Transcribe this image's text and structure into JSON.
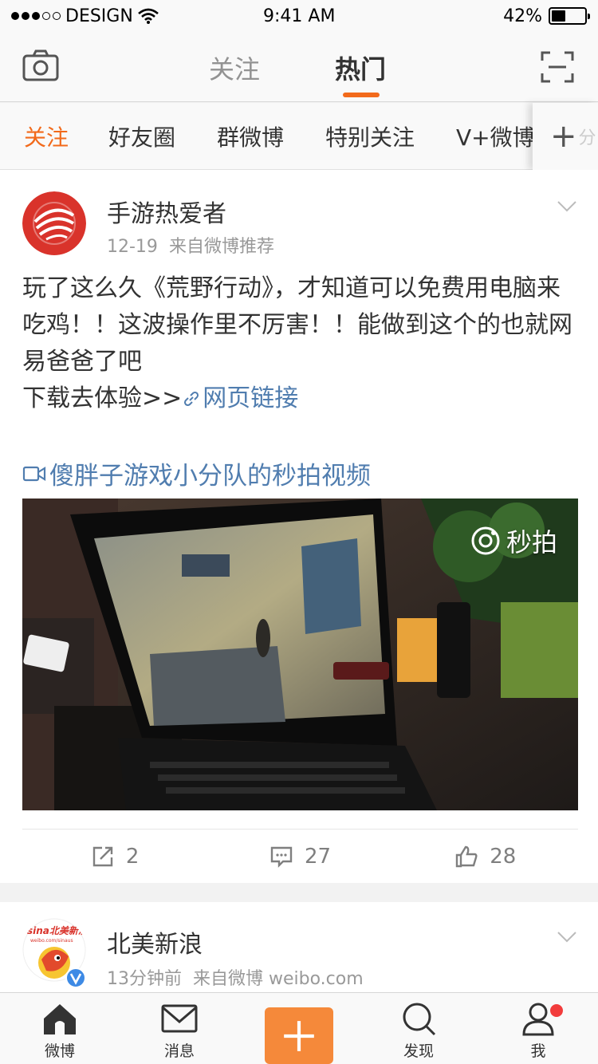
{
  "status_bar": {
    "carrier": "DESIGN",
    "time": "9:41 AM",
    "battery_percent": "42%",
    "battery_level": 0.42,
    "signal_bars_filled": 3,
    "signal_bars_total": 5
  },
  "nav": {
    "tab_follow": "关注",
    "tab_hot": "热门",
    "active_tab": "热门",
    "camera_icon": "camera-icon",
    "scan_icon": "scan-icon"
  },
  "groups": {
    "items": [
      "关注",
      "好友圈",
      "群微博",
      "特别关注",
      "V+微博"
    ],
    "active_index": 0,
    "add_symbol": "+",
    "add_fade": "分"
  },
  "post1": {
    "author": "手游热爱者",
    "date": "12-19",
    "source": "来自微博推荐",
    "text_line1": "玩了这么久《荒野行动》，才知道可以免费用电脑来吃鸡！！这波操作里不厉害！！能做到这个的也就网易爸爸了吧",
    "text_prefix": "下载去体验>>",
    "link_text": "网页链接",
    "video_link": "傻胖子游戏小分队的秒拍视频",
    "video_watermark": "秒拍",
    "repost_count": "2",
    "comment_count": "27",
    "like_count": "28"
  },
  "post2": {
    "author": "北美新浪",
    "time": "13分钟前",
    "source": "来自微博 weibo.com",
    "avatar_text": "sina北美新浪",
    "avatar_sub": "weibo.com/sinaus",
    "verified": true
  },
  "tabbar": {
    "home": "微博",
    "messages": "消息",
    "discover": "发现",
    "me": "我",
    "me_has_notification": true
  },
  "colors": {
    "accent": "#f26a1b",
    "link": "#507daf",
    "compose": "#f5893a"
  }
}
